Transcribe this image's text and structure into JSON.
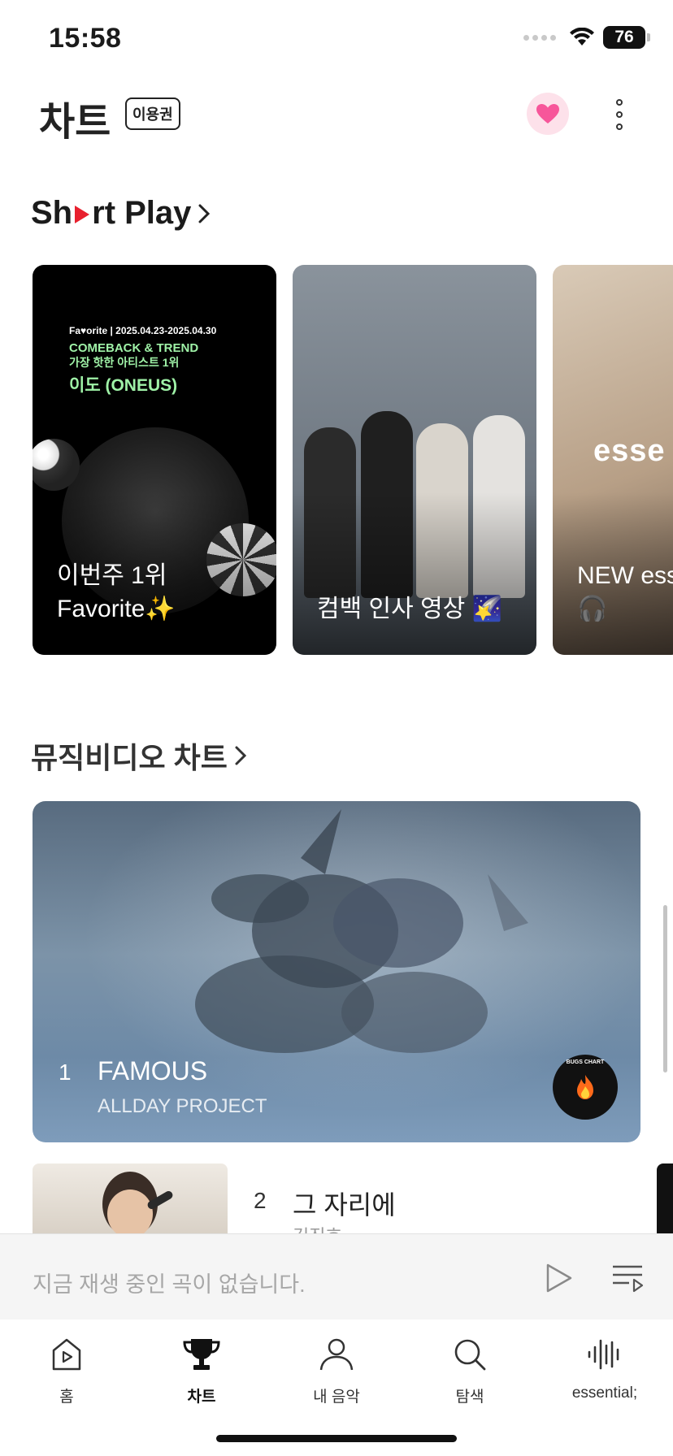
{
  "status_bar": {
    "time": "15:58",
    "battery": "76"
  },
  "header": {
    "title": "차트",
    "badge": "이용권"
  },
  "short_play": {
    "title": "Short Play",
    "cards": [
      {
        "caption_line1": "이번주 1위",
        "caption_line2": "Favorite✨",
        "promo_head": "Fa♥orite | 2025.04.23-2025.04.30",
        "promo_line1": "COMEBACK & TREND",
        "promo_line2": "가장 핫한 아티스트 1위",
        "promo_line3": "이도 (ONEUS)"
      },
      {
        "caption_line1": "컴백 인사 영상 🌠"
      },
      {
        "overlay_text": "esse",
        "caption_line1": "NEW ess",
        "caption_line2": "🎧"
      }
    ]
  },
  "mv_chart": {
    "title": "뮤직비디오 차트",
    "items": [
      {
        "rank": "1",
        "title": "FAMOUS",
        "artist": "ALLDAY PROJECT",
        "badge": "BUGS CHART"
      },
      {
        "rank": "2",
        "title": "그 자리에",
        "artist": "김진호"
      }
    ]
  },
  "mini_player": {
    "text": "지금 재생 중인 곡이 없습니다."
  },
  "nav": {
    "items": [
      {
        "label": "홈",
        "icon": "home-play-icon"
      },
      {
        "label": "차트",
        "icon": "trophy-icon"
      },
      {
        "label": "내 음악",
        "icon": "person-icon"
      },
      {
        "label": "탐색",
        "icon": "search-icon"
      },
      {
        "label": "essential;",
        "icon": "waveform-icon"
      }
    ],
    "active": "차트"
  },
  "colors": {
    "accent_red": "#e8202e",
    "heart_pink": "#f7569a",
    "heart_bg": "#fde1ea",
    "promo_green": "#9ff2a7"
  }
}
